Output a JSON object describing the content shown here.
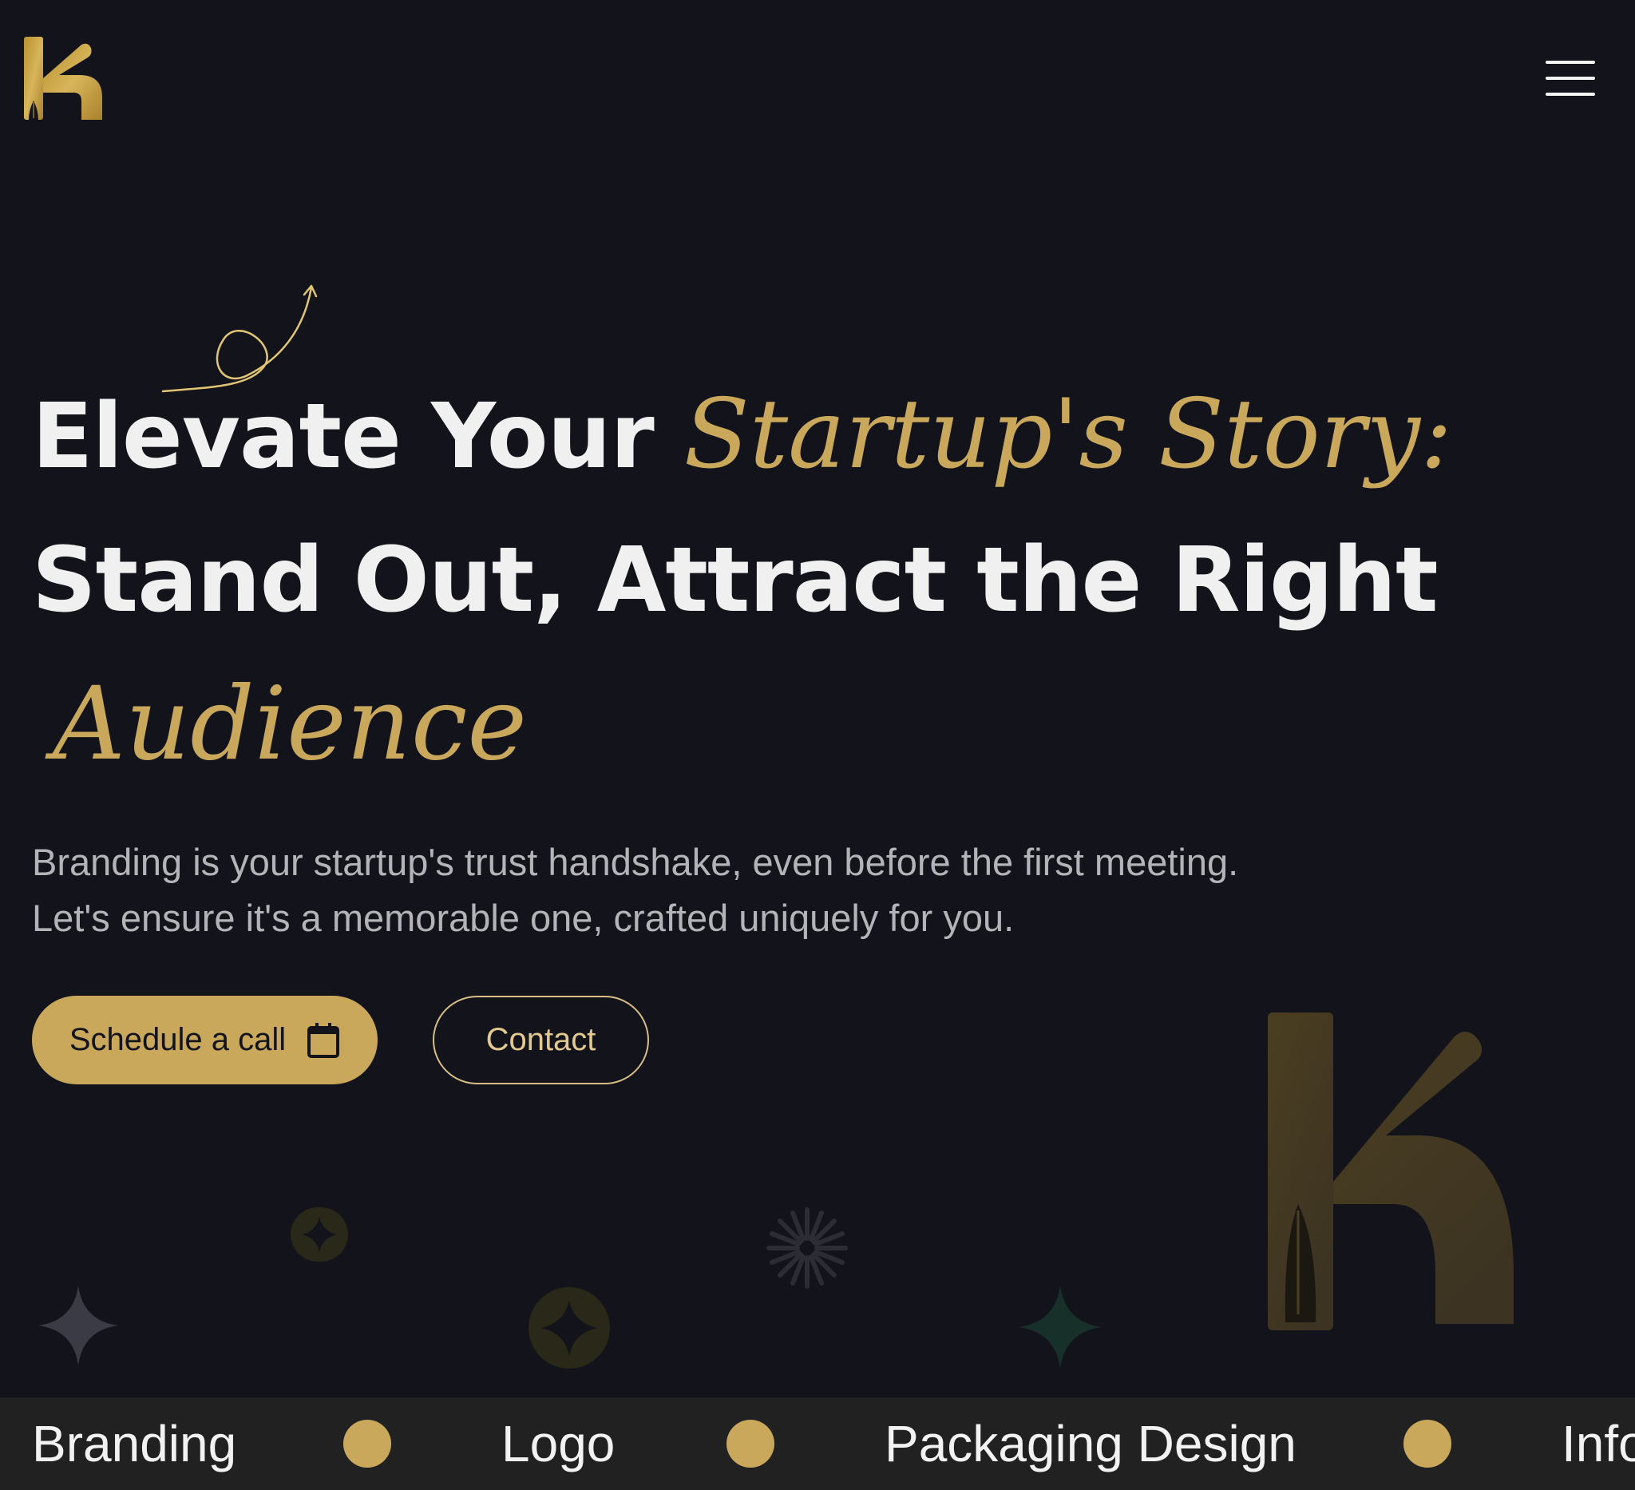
{
  "header": {
    "logo_icon": "k-pen-logo-icon",
    "menu_icon": "hamburger-menu-icon"
  },
  "hero": {
    "title_part1": "Elevate Your",
    "title_script1": "Startup's Story:",
    "title_line2": "Stand Out, Attract the Right",
    "title_script2": "Audience",
    "subtitle": "Branding is your startup's trust handshake, even before the first meeting. Let's ensure it's a memorable one, crafted uniquely for you.",
    "primary_button": "Schedule a call",
    "primary_button_icon": "calendar-icon",
    "secondary_button": "Contact"
  },
  "marquee": {
    "items": [
      "Branding",
      "Logo",
      "Packaging Design",
      "Info"
    ]
  },
  "colors": {
    "background": "#12131b",
    "accent_gold": "#c9a85c",
    "heading": "#f0f0f0",
    "body_text": "#b3b3b8",
    "marquee_bg": "#212121"
  }
}
